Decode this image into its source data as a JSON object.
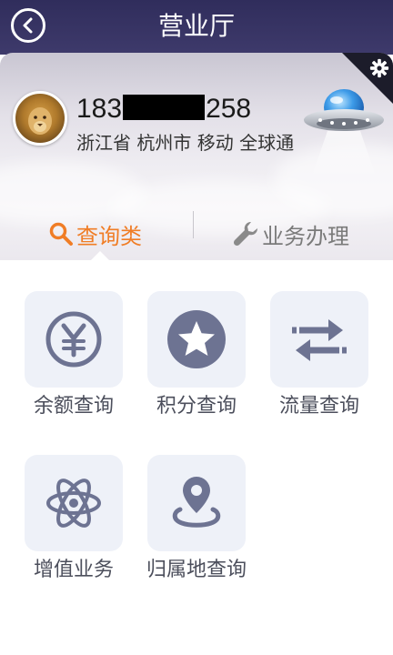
{
  "header": {
    "title": "营业厅"
  },
  "profile": {
    "phone_prefix": "183",
    "phone_suffix": "258",
    "location": "浙江省 杭州市 移动 全球通"
  },
  "tabs": [
    {
      "label": "查询类",
      "icon": "search-icon",
      "active": true
    },
    {
      "label": "业务办理",
      "icon": "wrench-icon",
      "active": false
    }
  ],
  "tiles": [
    {
      "label": "余额查询",
      "icon": "yen-coin-icon"
    },
    {
      "label": "积分查询",
      "icon": "star-badge-icon"
    },
    {
      "label": "流量查询",
      "icon": "transfer-arrows-icon"
    },
    {
      "label": "增值业务",
      "icon": "atom-icon"
    },
    {
      "label": "归属地查询",
      "icon": "location-pin-icon"
    }
  ],
  "colors": {
    "header_bg": "#302d5c",
    "active_tab": "#f07d26",
    "inactive_tab": "#7a7a7a",
    "icon_color": "#6d7392",
    "tile_bg": "#eef1f8"
  }
}
